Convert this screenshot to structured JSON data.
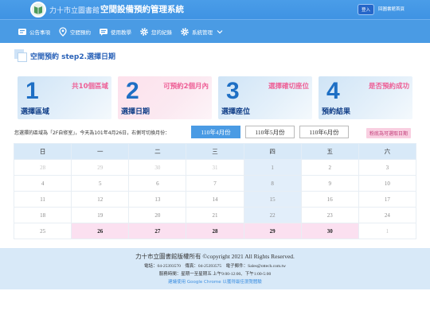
{
  "header": {
    "site_name": "力十市立圖書館",
    "system_name": "空間設備預約管理系統",
    "login_label": "登入",
    "back_label": "回圖書館首頁"
  },
  "nav": {
    "items": [
      {
        "label": "公告事項",
        "icon": "megaphone-icon"
      },
      {
        "label": "空間預約",
        "icon": "location-pin-icon"
      },
      {
        "label": "使用教學",
        "icon": "chat-icon"
      },
      {
        "label": "您的紀錄",
        "icon": "gear-icon"
      },
      {
        "label": "系統管理",
        "icon": "gear-icon"
      }
    ]
  },
  "step": {
    "title": "空間預約 step2.選擇日期"
  },
  "cards": [
    {
      "num": "1",
      "caption": "選擇區域",
      "tag": "共10個區域"
    },
    {
      "num": "2",
      "caption": "選擇日期",
      "tag": "可預約2個月內"
    },
    {
      "num": "3",
      "caption": "選擇座位",
      "tag": "選擇確切座位"
    },
    {
      "num": "4",
      "caption": "預約結果",
      "tag": "是否預約成功"
    }
  ],
  "info_text": "您選擇的區域為「2F自修室」，今天為101年4月26日，右側可切換月份：",
  "months": [
    "110年4月份",
    "110年5月份",
    "110年6月份"
  ],
  "legend_label": "粉底為可選取日期",
  "calendar": {
    "headers": [
      "日",
      "一",
      "二",
      "三",
      "四",
      "五",
      "六"
    ],
    "rows": [
      [
        "28",
        "29",
        "30",
        "31",
        "1",
        "2",
        "3"
      ],
      [
        "4",
        "5",
        "6",
        "7",
        "8",
        "9",
        "10"
      ],
      [
        "11",
        "12",
        "13",
        "14",
        "15",
        "16",
        "17"
      ],
      [
        "18",
        "19",
        "20",
        "21",
        "22",
        "23",
        "24"
      ],
      [
        "25",
        "26",
        "27",
        "28",
        "29",
        "30",
        "1"
      ]
    ]
  },
  "footer": {
    "line1": "力十市立圖書館版權所有 ©copyright 2021 All Rights Reserved.",
    "line2": "電話：04-25393570　傳真：04-25393575　電子郵件：Sales@ottech.com.tw",
    "line3": "服務時間：星期一至星期五 上午9:00-12:00、下午1:00-5:00",
    "line4": "建議使用 Google Chrome 以獲得最佳瀏覽體驗"
  },
  "colors": {
    "header_blue": "#4a9de8",
    "accent_pink": "#ee5f96",
    "available_pink": "#fbe0f0"
  }
}
